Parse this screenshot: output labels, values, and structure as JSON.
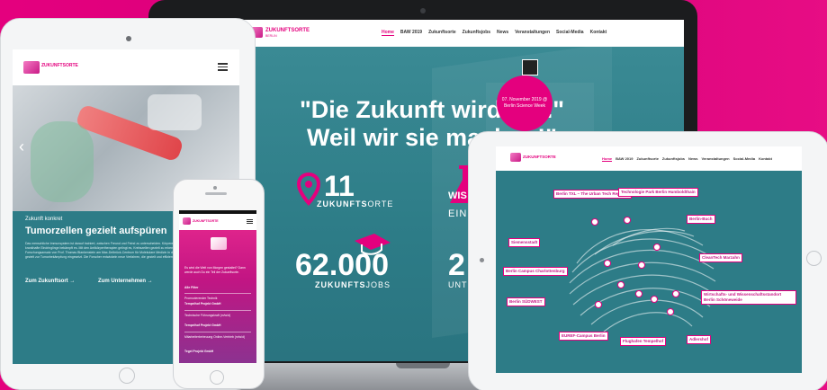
{
  "laptop": {
    "brand": "ZUKUNFTSORTE",
    "brand_sub": "BERLIN",
    "nav": [
      "Home",
      "BAW 2019",
      "Zukunftsorte",
      "Zukunftsjobs",
      "News",
      "Veranstaltungen",
      "Social-Media",
      "Kontakt"
    ],
    "quote_line1": "\"Die Zukunft wird gut.\"",
    "quote_line2": "Weil wir sie machen!\"",
    "badge_text": "07. November 2019 @ Berlin Science Week",
    "stat1_num": "11",
    "stat1_label_bold": "ZUKUNFTS",
    "stat1_label_rest": "ORTE",
    "stat2_partial_top": "WIS",
    "stat2_partial_bottom": "EIN",
    "stat3_num": "62.000",
    "stat3_label_bold": "ZUKUNFTS",
    "stat3_label_rest": "JOBS",
    "stat4_partial_num": "2",
    "stat4_partial_label": "UNT"
  },
  "tablet_left": {
    "brand": "ZUKUNFTSORTE",
    "kicker": "Zukunft konkret",
    "title": "Tumorzellen gezielt aufspüren",
    "body": "Das menschliche Immunsystem ist darauf trainiert, zwischen Freund und Feind zu unterscheiden. Körpereigene Zellen lässt es in Ruhe, krankhafte Eindringlinge bekämpft es. Mit den Antikörpertherapien gelingt es, Krebszellen gezielt zu erkennen und zu markieren. Einen Forschungsansatz von Prof. Thomas Blankenstein am Max-Delbrück-Centrum für Molekulare Medizin in der Berlin-Buch wird das Immunsystem gezielt zur Tumorbekämpfung eingesetzt. Die Forscher entwickeln neue Verfahren, die gezielt und effizient wirken.",
    "link1": "Zum Zukunftsort →",
    "link2": "Zum Unternehmen →"
  },
  "phone": {
    "brand": "ZUKUNFTSORTE",
    "intro": "Es wird die Welt von Morgen gestaltet? Dann werde auch Du ein Teil der Zukunftsorte.",
    "filter": "Alle Filter",
    "jobs": [
      {
        "title": "Promovierender Technik",
        "company": "Tempelhof Projekt GmbH"
      },
      {
        "title": "Technische Führungskraft (m/w/d)",
        "company": "Tempelhof Projekt GmbH"
      },
      {
        "title": "Mitarbeiterbetreuung Online-Vertrieb (m/w/d)",
        "company": "Tegel Projekt GmbH"
      }
    ]
  },
  "tablet_right": {
    "brand": "ZUKUNFTSORTE",
    "nav": [
      "Home",
      "BAW 2019",
      "Zukunftsorte",
      "Zukunftsjobs",
      "News",
      "Veranstaltungen",
      "Social-Media",
      "Kontakt"
    ],
    "map_labels": [
      "Berlin TXL – The Urban Tech Republic",
      "Technologie Park Berlin Humboldthain",
      "Berlin-Buch",
      "Siemensstadt",
      "CleanTech Marzahn",
      "Berlin Campus Charlottenburg",
      "Berlin SÜDWEST",
      "Wirtschafts- und Wissenschaftsstandort Berlin Schöneweide",
      "EUREF-Campus Berlin",
      "Flughafen Tempelhof",
      "Adlershof"
    ]
  },
  "colors": {
    "background": "#e4007e",
    "teal": "#2d7c87",
    "accent": "#e4007e"
  }
}
